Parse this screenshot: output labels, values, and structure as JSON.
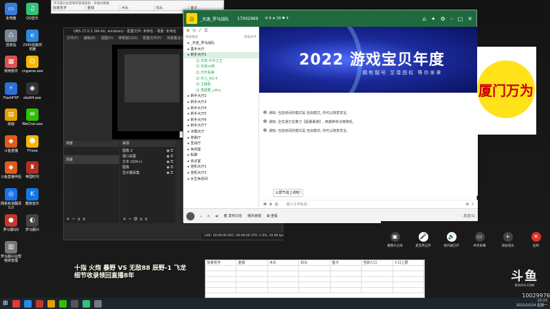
{
  "excel_top": {
    "title": "罗马服兴业帮物资管理系统 - 单格式数据",
    "headers": [
      "玩家名字",
      "金钱",
      "木头",
      "石头",
      "金子"
    ]
  },
  "desktop_icons": [
    {
      "label": "此电脑",
      "color": "#3a7bd5",
      "glyph": "▭"
    },
    {
      "label": "回收站",
      "color": "#7a8896",
      "glyph": "♺"
    },
    {
      "label": "常用软件",
      "color": "#d9534f",
      "glyph": "▦"
    },
    {
      "label": "FlashFXP",
      "color": "#2a6fd6",
      "glyph": "⚡"
    },
    {
      "label": "桌面",
      "color": "#e0a000",
      "glyph": "▤"
    },
    {
      "label": "斗鱼直播",
      "color": "#e05a1a",
      "glyph": "◆"
    },
    {
      "label": "斗鱼直播伴侣",
      "color": "#e05a1a",
      "glyph": "◆"
    },
    {
      "label": "网易有道翻译 5.0",
      "color": "#1a73e8",
      "glyph": "◎"
    },
    {
      "label": "罗马服QQ",
      "color": "#c0392b",
      "glyph": "●"
    },
    {
      "label": "罗马服兴业帮物资管理",
      "color": "#777",
      "glyph": "▥"
    },
    {
      "label": "QQ音乐",
      "color": "#31c27c",
      "glyph": "♫"
    },
    {
      "label": "2345加速浏览器",
      "color": "#2a8ae0",
      "glyph": "e"
    },
    {
      "label": "cngame.exe",
      "color": "#f5b800",
      "glyph": "☺"
    },
    {
      "label": "obs64.exe",
      "color": "#333",
      "glyph": "◉"
    },
    {
      "label": "WeChat.exe",
      "color": "#2dc100",
      "glyph": "✉"
    },
    {
      "label": "YY.exe",
      "color": "#f5b800",
      "glyph": "☻"
    },
    {
      "label": "帝国时代",
      "color": "#b03020",
      "glyph": "♜"
    },
    {
      "label": "酷狗音乐",
      "color": "#1577e6",
      "glyph": "K"
    },
    {
      "label": "罗马服兴",
      "color": "#444",
      "glyph": "◐"
    }
  ],
  "obs": {
    "title": "OBS 27.0.1 (64-bit, windows) - 配置文件: 未命名 - 场景: 未命名",
    "menu": [
      "文件(F)",
      "编辑(E)",
      "视图(V)",
      "停靠窗口(D)",
      "配置文件(P)",
      "场景集合(S)",
      "工具(T)",
      "帮助(H)"
    ],
    "scenes_header": "来源",
    "scenes_label": "场景",
    "scene_item": "场景",
    "sources_header": "来源",
    "sources": [
      "图像 2",
      "窗口采集",
      "文本 (GDI+)",
      "图像",
      "显示器采集"
    ],
    "tooltip": "5 电平时刷新(0)",
    "status": "LIVE: 00:00:00   REC: 00:00:00   CPU: 1.0%, 30.00 fps"
  },
  "client": {
    "username": "_天逸_罗马战队",
    "user_id": "17002969",
    "status_icons": "✉ 9 ★ 29 ♥ 4",
    "tabs": [
      "⌂",
      "✦",
      "⚙"
    ],
    "tree_header": "目录模式",
    "tree_hint": "帮助文件",
    "tree": [
      {
        "label": "_天逸_罗马战队",
        "type": "item"
      },
      {
        "label": "基手大厅",
        "type": "item"
      },
      {
        "label": "新手大厅1",
        "type": "active"
      },
      {
        "label": "天逸-半手之王",
        "type": "sub"
      },
      {
        "label": "天逸vs帆",
        "type": "sub"
      },
      {
        "label": "日日看美",
        "type": "sub"
      },
      {
        "label": "月儿_RO.4",
        "type": "sub"
      },
      {
        "label": "主播看",
        "type": "sub"
      },
      {
        "label": "再建要_ultra",
        "type": "sub"
      },
      {
        "label": "新手大厅2",
        "type": "item"
      },
      {
        "label": "新手大厅3",
        "type": "item"
      },
      {
        "label": "新手大厅4",
        "type": "item"
      },
      {
        "label": "新手大厅5",
        "type": "item"
      },
      {
        "label": "新手大厅6",
        "type": "item"
      },
      {
        "label": "新手大厅7",
        "type": "item"
      },
      {
        "label": "冰模大厅",
        "type": "item"
      },
      {
        "label": "单挑厅",
        "type": "item"
      },
      {
        "label": "圣战厅",
        "type": "item"
      },
      {
        "label": "休闲室",
        "type": "item"
      },
      {
        "label": "私聊",
        "type": "item"
      },
      {
        "label": "会议室",
        "type": "item"
      },
      {
        "label": "挂机大厅1",
        "type": "item"
      },
      {
        "label": "挂机大厅2",
        "type": "item"
      },
      {
        "label": "女生休息间",
        "type": "item"
      }
    ],
    "banner_title": "2022 游戏宝贝年度",
    "banner_sub": "拥有靓号  至尊图标  等你来拿",
    "messages": [
      "通知: 当前房间的模式是 自由模式, 你可以随意发言。",
      "通知: 全优通已在推力【超暑暴袭】, 用捕神单点用降低。",
      "通知: 当前房间的模式是 自由模式, 你可以随意发言。"
    ],
    "bubble": "公屏气泡上线啦!",
    "input_placeholder": "输入文字私信...",
    "bottom_items": [
      "麦 发布讨论",
      "频外旅观",
      "✪ 查看"
    ],
    "send_label": "发送(S)"
  },
  "ad": {
    "text": "厦门万为"
  },
  "meeting": {
    "buttons": [
      {
        "label": "摄像头已关",
        "glyph": "▣",
        "style": ""
      },
      {
        "label": "麦克风已开",
        "glyph": "🎤",
        "style": "white"
      },
      {
        "label": "扬声器已开",
        "glyph": "🔊",
        "style": "white"
      },
      {
        "label": "共享屏幕",
        "glyph": "▭",
        "style": ""
      },
      {
        "label": "添加成员",
        "glyph": "+",
        "style": ""
      },
      {
        "label": "挂断",
        "glyph": "✕",
        "style": "red"
      }
    ]
  },
  "caption": {
    "line1": "十指 火炮 暴野 VS 无敌88 辰野-1 飞龙",
    "line2": "细节收录领回直播8年"
  },
  "excel_bottom": {
    "headers": [
      "玩家名字",
      "金钱",
      "木头",
      "石头",
      "金子",
      "当前人口",
      "人口上限"
    ]
  },
  "douyu": {
    "logo": "斗鱼",
    "url": "DOUYU.COM",
    "room": "10029976"
  },
  "tray": {
    "time": "22:13",
    "date": "2022/10/24 星期一"
  }
}
